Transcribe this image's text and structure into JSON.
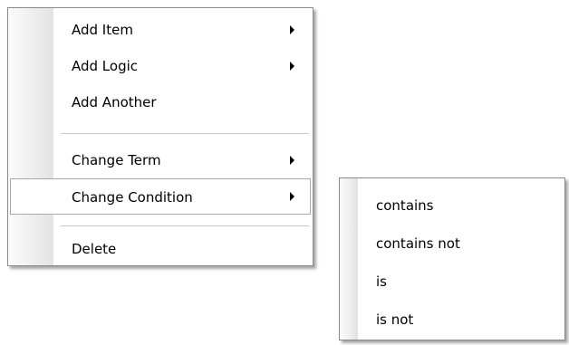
{
  "context_menu": {
    "items": [
      {
        "label": "Add Item",
        "has_submenu": true
      },
      {
        "label": "Add Logic",
        "has_submenu": true
      },
      {
        "label": "Add Another",
        "has_submenu": false
      },
      {
        "label": "Change Term",
        "has_submenu": true
      },
      {
        "label": "Change Condition",
        "has_submenu": true,
        "highlighted": true
      },
      {
        "label": "Delete",
        "has_submenu": false
      }
    ]
  },
  "condition_submenu": {
    "items": [
      {
        "label": "contains"
      },
      {
        "label": "contains not"
      },
      {
        "label": "is"
      },
      {
        "label": "is not"
      }
    ]
  },
  "icons": {
    "submenu_arrow": "chevron-right-icon"
  },
  "colors": {
    "menu_border": "#8a8a8a",
    "separator": "#c8c8c8",
    "highlight_border": "#a9a9a9"
  }
}
